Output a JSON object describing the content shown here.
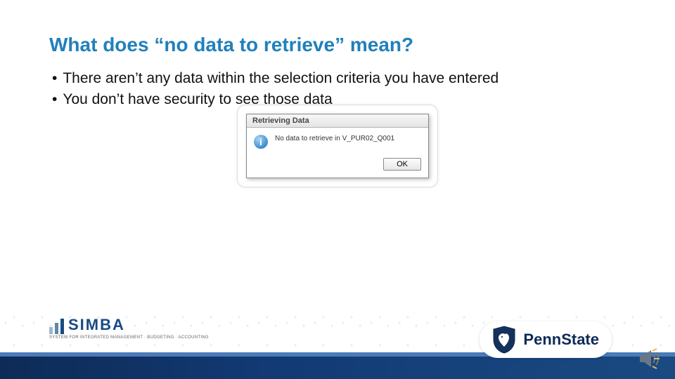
{
  "title": "What does “no data to retrieve” mean?",
  "bullets": [
    "There aren’t any data within the selection criteria you have entered",
    "You don’t have security to see those data"
  ],
  "dialog": {
    "title": "Retrieving Data",
    "message": "No data to retrieve in V_PUR02_Q001",
    "ok": "OK"
  },
  "simba": {
    "name": "SIMBA",
    "sub": "SYSTEM FOR INTEGRATED\nMANAGEMENT · BUDGETING · ACCOUNTING"
  },
  "pennstate": "PennState"
}
